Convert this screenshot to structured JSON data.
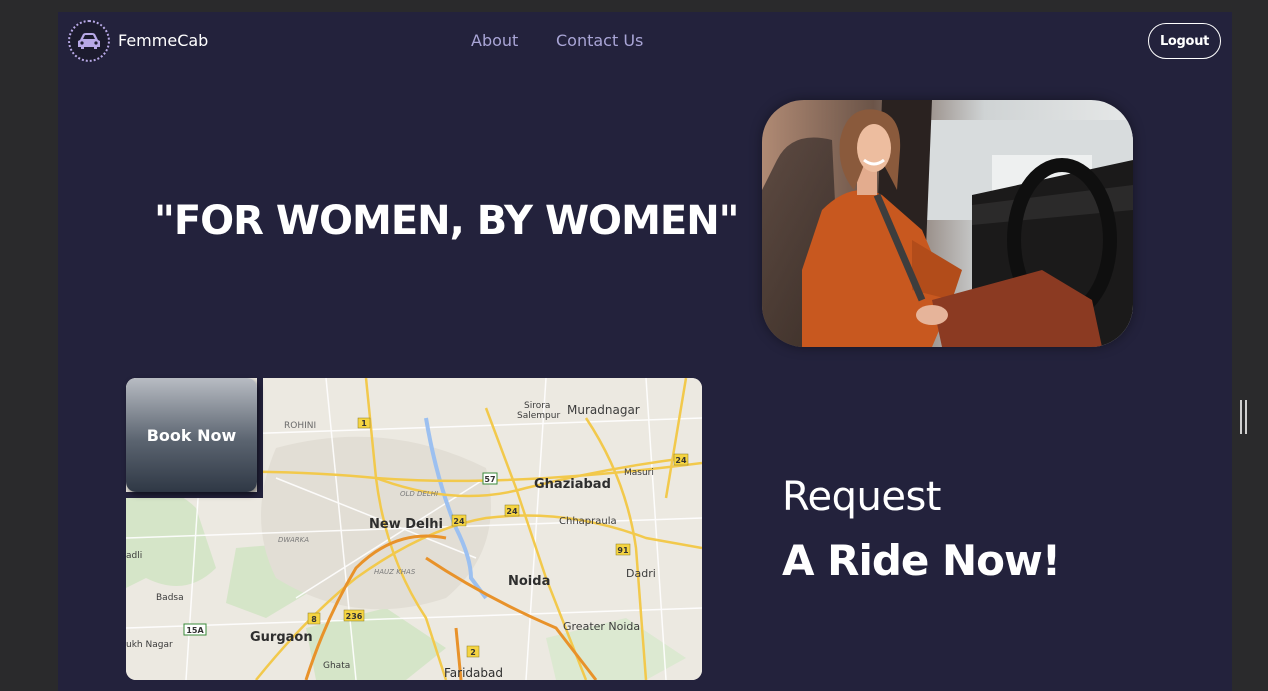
{
  "navbar": {
    "brand": "FemmeCab",
    "logo_icon": "car-icon",
    "links": [
      "About",
      "Contact Us"
    ],
    "logout_label": "Logout"
  },
  "hero": {
    "tagline": "\"FOR WOMEN, BY WOMEN\""
  },
  "booking": {
    "book_label": "Book Now",
    "request_line1": "Request",
    "request_line2": "A Ride Now!"
  },
  "map": {
    "places": {
      "rohini": "ROHINI",
      "sirora": "Sirora",
      "salempur": "Salempur",
      "muradnagar": "Muradnagar",
      "masuri": "Masuri",
      "old_delhi": "OLD DELHI",
      "ghaziabad": "Ghaziabad",
      "new_delhi": "New Delhi",
      "chhapraula": "Chhapraula",
      "dwarka": "DWARKA",
      "hauz_khas": "HAUZ KHAS",
      "noida": "Noida",
      "dadri": "Dadri",
      "badli": "adli",
      "badsa": "Badsa",
      "gurgaon": "Gurgaon",
      "greater_noida": "Greater Noida",
      "ukh_nagar": "ukh Nagar",
      "ghata": "Ghata",
      "faridabad": "Faridabad"
    },
    "shields": {
      "r1": "1",
      "r57": "57",
      "r24a": "24",
      "r24b": "24",
      "r24c": "24",
      "r91": "91",
      "r8": "8",
      "r236": "236",
      "r15a": "15A",
      "r2": "2"
    }
  },
  "colors": {
    "background": "#23223c",
    "nav_link": "#a9a5d6",
    "text": "#ffffff"
  }
}
